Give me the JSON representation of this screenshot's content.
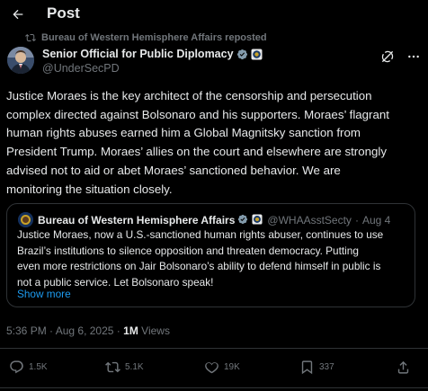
{
  "header": {
    "title": "Post"
  },
  "repost": {
    "text": "Bureau of Western Hemisphere Affairs reposted"
  },
  "author": {
    "name": "Senior Official for Public Diplomacy",
    "handle": "@UnderSecPD"
  },
  "post": {
    "text": "Justice Moraes is the key architect of the censorship and persecution\ncomplex directed against Bolsonaro and his supporters. Moraes’ flagrant\nhuman rights abuses earned him a Global Magnitsky sanction from\nPresident Trump. Moraes’ allies on the court and elsewhere are strongly\nadvised not to aid or abet Moraes’ sanctioned behavior. We are\nmonitoring the situation closely."
  },
  "quote": {
    "name": "Bureau of Western Hemisphere Affairs",
    "handle": "@WHAAsstSecty",
    "separator": "·",
    "date": "Aug 4",
    "text": "Justice Moraes, now a U.S.-sanctioned human rights abuser, continues to use\nBrazil’s institutions to silence opposition and threaten democracy.  Putting\neven more restrictions on Jair Bolsonaro’s ability to defend himself in public is\nnot a public service. Let Bolsonaro speak!",
    "show_more": "Show more"
  },
  "meta": {
    "time": "5:36 PM",
    "date": "Aug 6, 2025",
    "dot": "·",
    "views_count": "1M",
    "views_label": "Views"
  },
  "actions": {
    "replies": "1.5K",
    "reposts": "5.1K",
    "likes": "19K",
    "bookmarks": "337"
  },
  "colors": {
    "background": "#000000",
    "text": "#e7e9ea",
    "muted": "#71767b",
    "link": "#1d9bf0",
    "verified": "#829aab",
    "border": "#2f3336"
  },
  "icons": [
    "back-arrow-icon",
    "repost-icon",
    "verified-badge-icon",
    "affiliation-seal-icon",
    "grok-icon",
    "more-icon",
    "reply-icon",
    "like-icon",
    "bookmark-icon"
  ]
}
